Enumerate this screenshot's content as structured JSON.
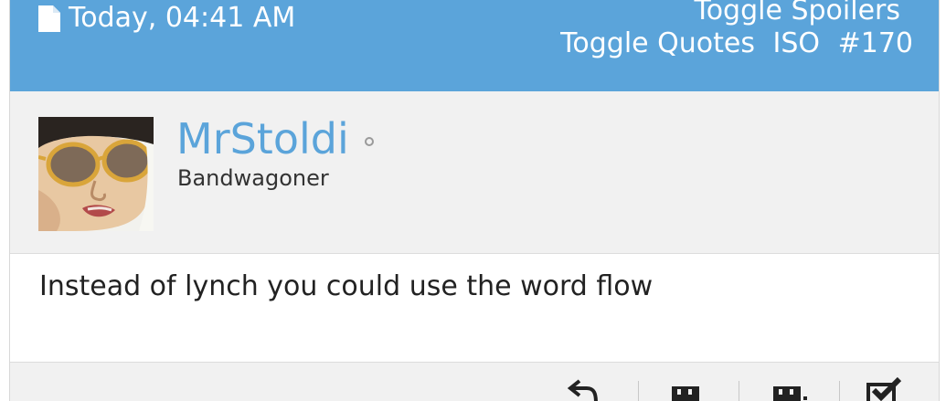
{
  "header": {
    "date": "Today, 04:41 AM",
    "toggle_spoilers": "Toggle Spoilers",
    "toggle_quotes": "Toggle Quotes",
    "iso": "ISO",
    "post_number": "#170"
  },
  "user": {
    "name": "MrStoldi",
    "title": "Bandwagoner",
    "status": "offline"
  },
  "post": {
    "message": "Instead of lynch you could use the word flow"
  },
  "footer": {
    "icons": [
      "reply-icon",
      "quote-icon",
      "multiquote-icon",
      "checkbox-icon"
    ]
  },
  "colors": {
    "header_bg": "#5ba4da",
    "username": "#5ba4da",
    "panel_bg": "#f1f1f1"
  }
}
